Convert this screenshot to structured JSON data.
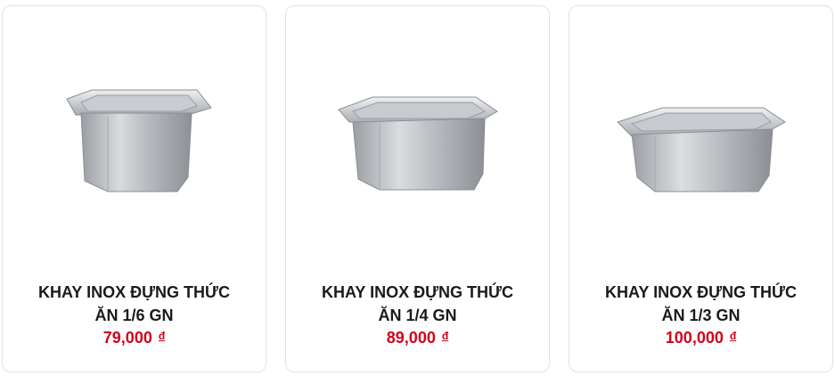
{
  "products": [
    {
      "name_line1": "KHAY INOX ĐỰNG THỨC",
      "name_line2": "ĂN 1/6 GN",
      "price": "79,000",
      "currency": "đ",
      "image_icon": "stainless-steel-pan-1-6-gn"
    },
    {
      "name_line1": "KHAY INOX ĐỰNG THỨC",
      "name_line2": "ĂN 1/4 GN",
      "price": "89,000",
      "currency": "đ",
      "image_icon": "stainless-steel-pan-1-4-gn"
    },
    {
      "name_line1": "KHAY INOX ĐỰNG THỨC",
      "name_line2": "ĂN 1/3 GN",
      "price": "100,000",
      "currency": "đ",
      "image_icon": "stainless-steel-pan-1-3-gn"
    }
  ],
  "colors": {
    "price": "#d0021b",
    "title": "#1a1a1a",
    "card_border": "#e2e2e2"
  }
}
